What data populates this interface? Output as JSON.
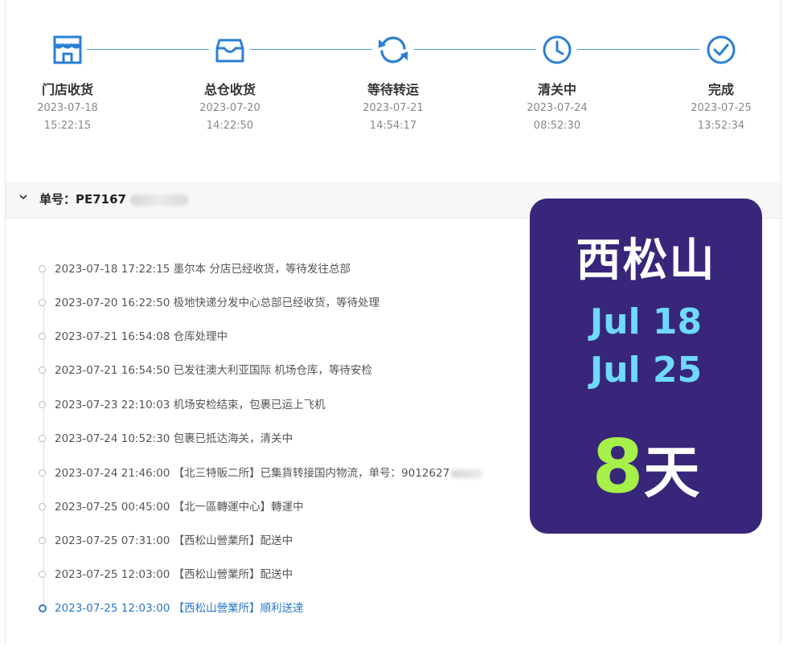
{
  "steps": [
    {
      "label": "门店收货",
      "date": "2023-07-18",
      "time": "15:22:15",
      "icon": "store-icon"
    },
    {
      "label": "总仓收货",
      "date": "2023-07-20",
      "time": "14:22:50",
      "icon": "box-icon"
    },
    {
      "label": "等待转运",
      "date": "2023-07-21",
      "time": "14:54:17",
      "icon": "sync-icon"
    },
    {
      "label": "清关中",
      "date": "2023-07-24",
      "time": "08:52:30",
      "icon": "clock-icon"
    },
    {
      "label": "完成",
      "date": "2023-07-25",
      "time": "13:52:34",
      "icon": "check-circle-icon"
    }
  ],
  "order": {
    "label": "单号：PE7167",
    "chevron": "chevron-down-icon"
  },
  "events": [
    "2023-07-18 17:22:15 墨尔本 分店已经收货，等待发往总部",
    "2023-07-20 16:22:50 极地快递分发中心总部已经收货，等待处理",
    "2023-07-21 16:54:08 仓库处理中",
    "2023-07-21 16:54:50 已发往澳大利亚国际 机场仓库，等待安检",
    "2023-07-23 22:10:03 机场安检结束，包裹已运上飞机",
    "2023-07-24 10:52:30 包裹已抵达海关，清关中",
    "2023-07-24 21:46:00 【北三特販二所】已集貨转接国内物流，单号：9012627",
    "2023-07-25 00:45:00 【北一區轉運中心】轉運中",
    "2023-07-25 07:31:00 【西松山營業所】配送中",
    "2023-07-25 12:03:00 【西松山營業所】配送中",
    "2023-07-25 12:03:00 【西松山營業所】順利送達"
  ],
  "card": {
    "city": "西松山",
    "date_start": "Jul 18",
    "date_end": "Jul 25",
    "days_num": "8",
    "days_unit": "天"
  },
  "colors": {
    "accent": "#2a76c6",
    "card_bg": "#38267a",
    "card_date": "#6fd9ff",
    "card_days": "#a6f049"
  }
}
